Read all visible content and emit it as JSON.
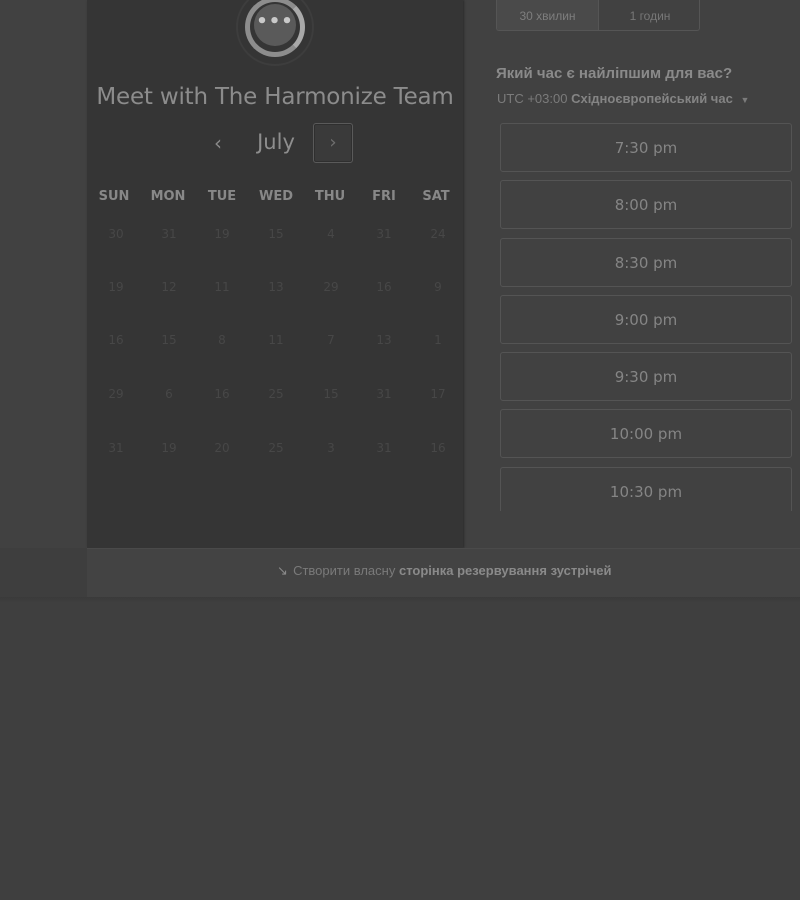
{
  "calendar": {
    "team_title": "Meet with The Harmonize Team",
    "month": "July",
    "prev_icon": "‹",
    "next_icon": "›",
    "logo_dots": "•••",
    "weekdays": [
      "SUN",
      "MON",
      "TUE",
      "WED",
      "THU",
      "FRI",
      "SAT"
    ],
    "weeks": [
      [
        "30",
        "31",
        "19",
        "15",
        "4",
        "31",
        "24"
      ],
      [
        "19",
        "12",
        "11",
        "13",
        "29",
        "16",
        "9"
      ],
      [
        "16",
        "15",
        "8",
        "11",
        "7",
        "13",
        "1"
      ],
      [
        "29",
        "6",
        "16",
        "25",
        "15",
        "31",
        "17"
      ],
      [
        "31",
        "19",
        "20",
        "25",
        "3",
        "31",
        "16"
      ]
    ]
  },
  "booking": {
    "durations": [
      "30 хвилин",
      "1 годин"
    ],
    "question": "Який час є найліпшим для вас?",
    "tz_offset": "UTC +03:00",
    "tz_name": "Східноєвропейський час",
    "tz_caret": "▼",
    "slots": [
      "7:30 pm",
      "8:00 pm",
      "8:30 pm",
      "9:00 pm",
      "9:30 pm",
      "10:00 pm",
      "10:30 pm"
    ]
  },
  "footer": {
    "icon": "↘",
    "prefix": "Створити власну",
    "link": "сторінка резервування зустрічей"
  }
}
